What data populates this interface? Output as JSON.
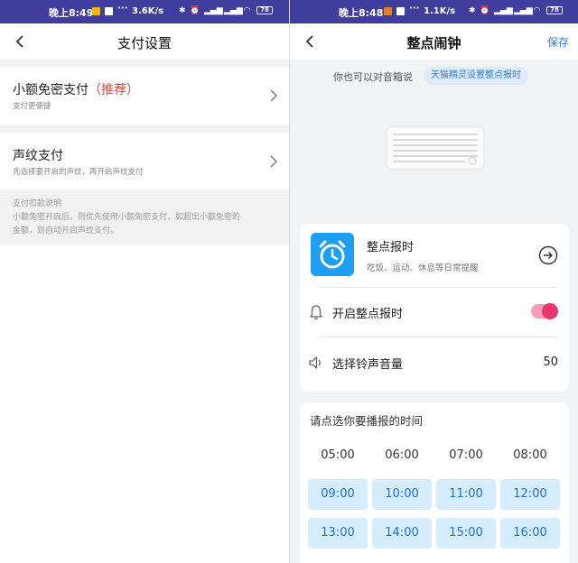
{
  "left_screen": {
    "status_bar": {
      "time": "晚上8:49",
      "speed": "3.6K/s",
      "battery": "78"
    },
    "header": {
      "title": "支付设置"
    },
    "rows": [
      {
        "title": "小额免密支付",
        "badge": "（推荐）",
        "subtitle": "支付更便捷"
      },
      {
        "title": "声纹支付",
        "subtitle": "先选择要开启的声纹，再开启声纹支付"
      }
    ],
    "note": {
      "title": "支付扣款说明",
      "line1": "小额免密开启后，则优先使用小额免密支付，如超出小额免密的",
      "line2": "金额，则自动开启声纹支付。"
    }
  },
  "right_screen": {
    "status_bar": {
      "time": "晚上8:48",
      "speed": "1.1K/s",
      "battery": "78"
    },
    "header": {
      "title": "整点闹钟",
      "save": "保存"
    },
    "hint": {
      "text": "你也可以对音箱说",
      "chip": "天猫精灵设置整点报时"
    },
    "feature": {
      "title": "整点报时",
      "subtitle": "吃饭、运动、休息等日常提醒"
    },
    "settings": {
      "toggle_label": "开启整点报时",
      "toggle_on": true,
      "volume_label": "选择铃声音量",
      "volume_value": "50"
    },
    "time_picker": {
      "title": "请点选你要播报的时间",
      "times": [
        "05:00",
        "06:00",
        "07:00",
        "08:00",
        "09:00",
        "10:00",
        "11:00",
        "12:00",
        "13:00",
        "14:00",
        "15:00",
        "16:00"
      ],
      "selected_count_from": 4
    }
  },
  "colors": {
    "status_bar": "#3f3d9e",
    "accent_blue": "#2f7fe0",
    "recommend_red": "#e5463b",
    "toggle_pink": "#e8366e",
    "time_chip_bg": "#d6ecff"
  }
}
